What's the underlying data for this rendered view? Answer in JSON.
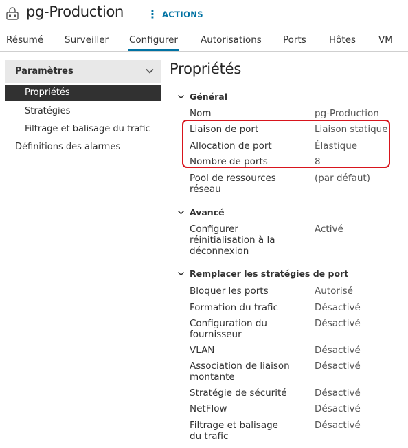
{
  "header": {
    "title": "pg-Production",
    "actions_label": "ACTIONS",
    "icon": "port-group-icon",
    "accent_color": "#0072a3"
  },
  "tabs": [
    {
      "label": "Résumé"
    },
    {
      "label": "Surveiller"
    },
    {
      "label": "Configurer",
      "active": true
    },
    {
      "label": "Autorisations"
    },
    {
      "label": "Ports"
    },
    {
      "label": "Hôtes"
    },
    {
      "label": "VM"
    }
  ],
  "sidebar": {
    "group_label": "Paramètres",
    "items": [
      {
        "label": "Propriétés",
        "selected": true
      },
      {
        "label": "Stratégies"
      },
      {
        "label": "Filtrage et balisage du trafic"
      }
    ],
    "alarm_definitions": "Définitions des alarmes"
  },
  "main": {
    "title": "Propriétés",
    "sections": {
      "general": {
        "label": "Général",
        "props": [
          {
            "key": "Nom",
            "value": "pg-Production"
          },
          {
            "key": "Liaison de port",
            "value": "Liaison statique"
          },
          {
            "key": "Allocation de port",
            "value": "Élastique"
          },
          {
            "key": "Nombre de ports",
            "value": "8"
          },
          {
            "key": "Pool de ressources réseau",
            "value": "(par défaut)"
          }
        ]
      },
      "advanced": {
        "label": "Avancé",
        "props": [
          {
            "key": "Configurer réinitialisation à la déconnexion",
            "value": "Activé"
          }
        ]
      },
      "override": {
        "label": "Remplacer les stratégies de port",
        "props": [
          {
            "key": "Bloquer les ports",
            "value": "Autorisé"
          },
          {
            "key": "Formation du trafic",
            "value": "Désactivé"
          },
          {
            "key": "Configuration du fournisseur",
            "value": "Désactivé"
          },
          {
            "key": "VLAN",
            "value": "Désactivé"
          },
          {
            "key": "Association de liaison montante",
            "value": "Désactivé"
          },
          {
            "key": "Stratégie de sécurité",
            "value": "Désactivé"
          },
          {
            "key": "NetFlow",
            "value": "Désactivé"
          },
          {
            "key": "Filtrage et balisage du trafic",
            "value": "Désactivé"
          }
        ]
      }
    }
  },
  "highlight_color": "#d8151d"
}
